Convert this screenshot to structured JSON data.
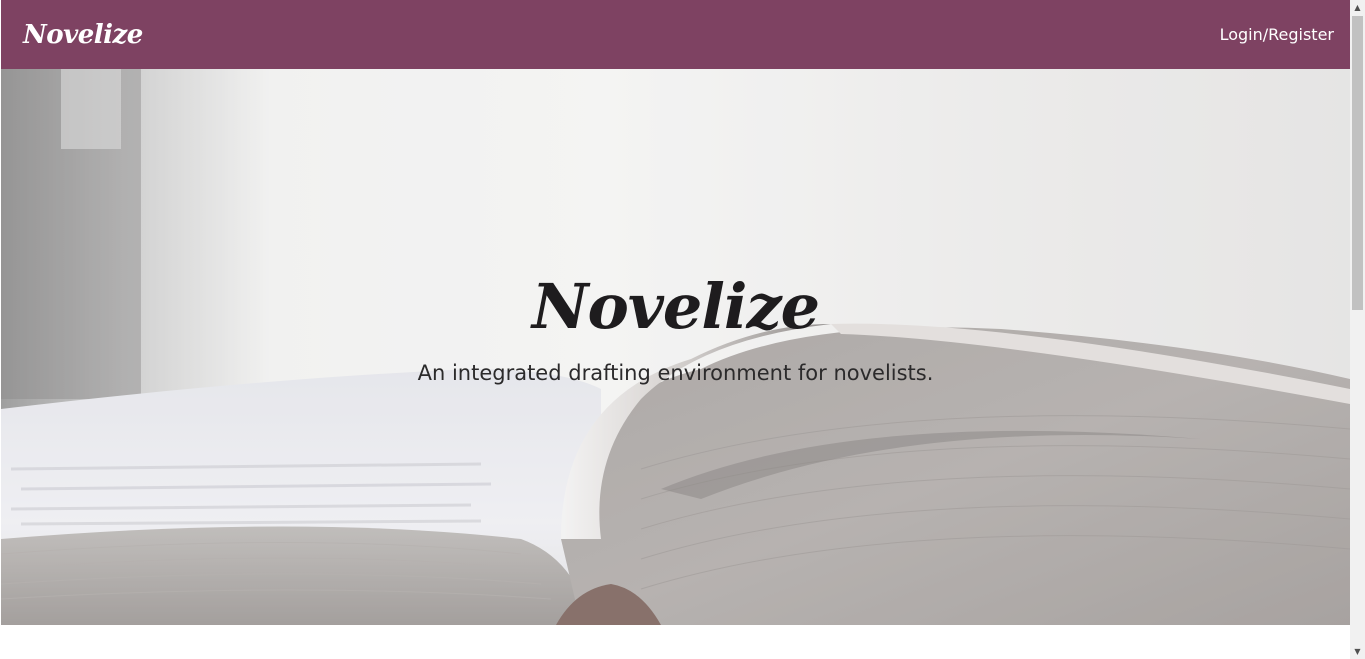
{
  "navbar": {
    "brand": "Novelize",
    "login_label": "Login/Register",
    "background_color": "#7e4262"
  },
  "hero": {
    "title": "Novelize",
    "subtitle": "An integrated drafting environment for novelists.",
    "background_image": "open-book-photo"
  },
  "scrollbar": {
    "up_icon": "▲",
    "down_icon": "▼"
  }
}
